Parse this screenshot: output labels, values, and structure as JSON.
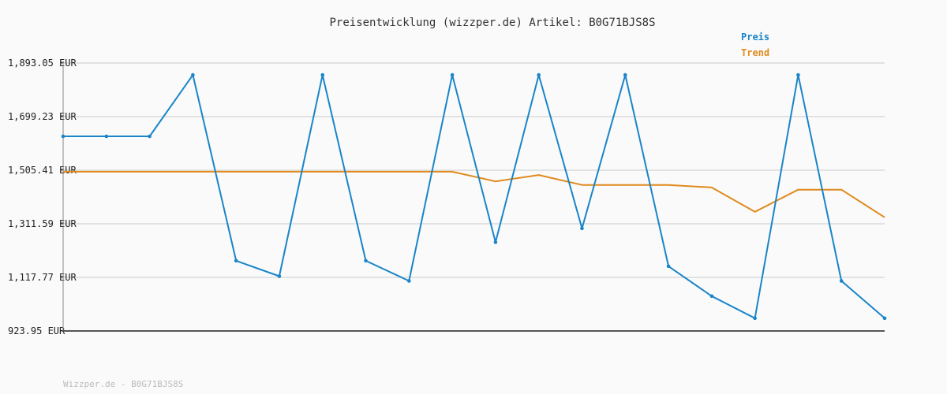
{
  "chart_data": {
    "type": "line",
    "title": "Preisentwicklung (wizzper.de) Artikel: B0G71BJS8S",
    "xlabel": "",
    "ylabel": "",
    "ylim": [
      923.95,
      1893.05
    ],
    "y_ticks": [
      "1,893.05 EUR",
      "1,699.23 EUR",
      "1,505.41 EUR",
      "1,311.59 EUR",
      "1,117.77 EUR",
      "923.95 EUR"
    ],
    "y_tick_values": [
      1893.05,
      1699.23,
      1505.41,
      1311.59,
      1117.77,
      923.95
    ],
    "grid": true,
    "legend_placement": "top-right",
    "x": [
      0,
      1,
      2,
      3,
      4,
      5,
      6,
      7,
      8,
      9,
      10,
      11,
      12,
      13,
      14,
      15,
      16,
      17,
      18,
      19
    ],
    "series": [
      {
        "name": "Preis",
        "color": "#1a85c8",
        "markers": true,
        "values": [
          1628,
          1628,
          1628,
          1850,
          1178,
          1122,
          1850,
          1178,
          1105,
          1850,
          1245,
          1850,
          1295,
          1850,
          1158,
          1050,
          970,
          1850,
          1105,
          970
        ]
      },
      {
        "name": "Trend",
        "color": "#e08a1e",
        "markers": false,
        "values": [
          1500,
          1500,
          1500,
          1500,
          1500,
          1500,
          1500,
          1500,
          1500,
          1500,
          1465,
          1488,
          1452,
          1452,
          1452,
          1443,
          1355,
          1435,
          1435,
          1335
        ]
      }
    ]
  },
  "footer": "Wizzper.de - B0G71BJS8S"
}
